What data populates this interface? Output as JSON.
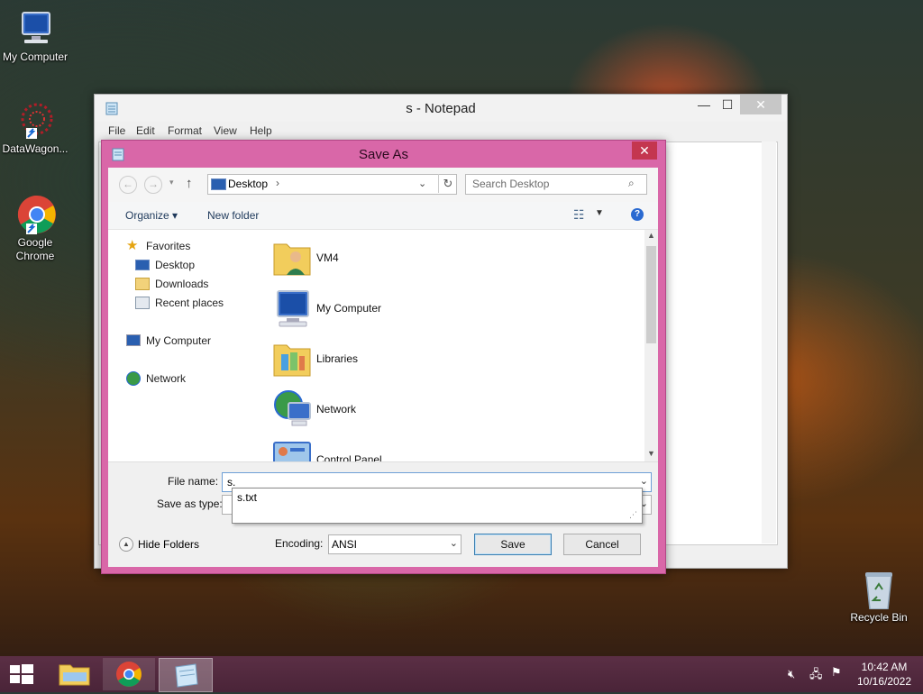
{
  "desktop": {
    "icons": [
      {
        "label": "My Computer"
      },
      {
        "label": "DataWagon..."
      },
      {
        "label": "Google Chrome"
      },
      {
        "label": "Recycle Bin"
      }
    ]
  },
  "notepad": {
    "title": "s - Notepad",
    "menu": [
      "File",
      "Edit",
      "Format",
      "View",
      "Help"
    ],
    "controls": {
      "minimize": "—",
      "maximize": "☐",
      "close": "✕"
    }
  },
  "save_dialog": {
    "title": "Save As",
    "close": "✕",
    "address": {
      "location": "Desktop",
      "separator": "›"
    },
    "search_placeholder": "Search Desktop",
    "toolbar": {
      "organize": "Organize ▾",
      "new_folder": "New folder"
    },
    "nav_pane": {
      "favorites": "Favorites",
      "favorites_items": [
        "Desktop",
        "Downloads",
        "Recent places"
      ],
      "my_computer": "My Computer",
      "network": "Network"
    },
    "files": [
      "VM4",
      "My Computer",
      "Libraries",
      "Network",
      "Control Panel"
    ],
    "file_name_label": "File name:",
    "file_name_value": "s.",
    "autocomplete_suggestion": "s.txt",
    "save_as_type_label": "Save as type:",
    "hide_folders": "Hide Folders",
    "encoding_label": "Encoding:",
    "encoding_value": "ANSI",
    "save_button": "Save",
    "cancel_button": "Cancel"
  },
  "taskbar": {
    "time": "10:42 AM",
    "date": "10/16/2022"
  },
  "colors": {
    "dialog_frame": "#d967a8",
    "taskbar": "#4a2438",
    "close_button": "#c4364f"
  }
}
